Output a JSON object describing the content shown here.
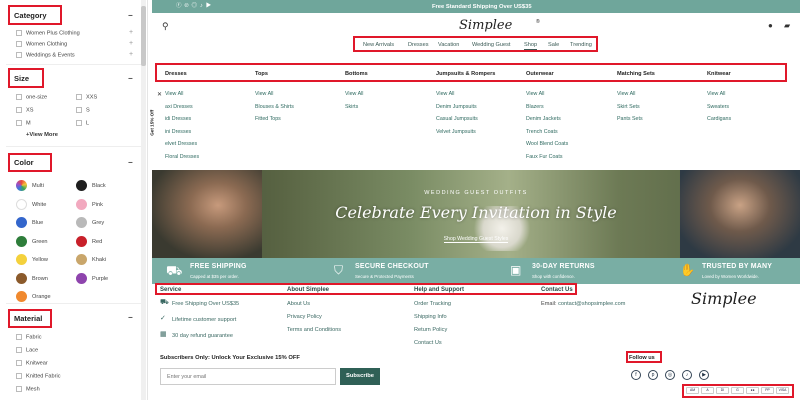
{
  "sidebar": {
    "category": {
      "title": "Category",
      "items": [
        "Women Plus Clothing",
        "Women Clothing",
        "Weddings & Events"
      ]
    },
    "size": {
      "title": "Size",
      "col1": [
        "one-size",
        "XS",
        "M"
      ],
      "col2": [
        "XXS",
        "S",
        "L"
      ],
      "more": "+View More"
    },
    "color": {
      "title": "Color",
      "items": [
        {
          "label": "Multi",
          "hex": "multi"
        },
        {
          "label": "Black",
          "hex": "#1e1e1e"
        },
        {
          "label": "White",
          "hex": "#ffffff"
        },
        {
          "label": "Pink",
          "hex": "#f2a9bf"
        },
        {
          "label": "Blue",
          "hex": "#3366cc"
        },
        {
          "label": "Grey",
          "hex": "#b9b9b9"
        },
        {
          "label": "Green",
          "hex": "#2e7d3a"
        },
        {
          "label": "Red",
          "hex": "#c8202a"
        },
        {
          "label": "Yellow",
          "hex": "#f4d13c"
        },
        {
          "label": "Khaki",
          "hex": "#c9a66b"
        },
        {
          "label": "Brown",
          "hex": "#8b5a2b"
        },
        {
          "label": "Purple",
          "hex": "#8e44ad"
        },
        {
          "label": "Orange",
          "hex": "#f0892e"
        }
      ]
    },
    "material": {
      "title": "Material",
      "items": [
        "Fabric",
        "Lace",
        "Knitwear",
        "Knitted Fabric",
        "Mesh"
      ]
    }
  },
  "topbar": {
    "shipping_text": "Free Standard Shipping Over US$35"
  },
  "header": {
    "logo": "Simplee"
  },
  "nav": [
    "New Arrivals",
    "Dresses",
    "Vacation",
    "Wedding Guest",
    "Shop",
    "Sale",
    "Trending"
  ],
  "mega_menu": {
    "side_tab": "Get 15% Off",
    "columns": [
      {
        "title": "Dresses",
        "items": [
          "View All",
          "axi Dresses",
          "idi Dresses",
          "ini Dresses",
          "elvet Dresses",
          "Floral Dresses"
        ]
      },
      {
        "title": "Tops",
        "items": [
          "View All",
          "Blouses & Shirts",
          "Fitted Tops"
        ]
      },
      {
        "title": "Bottoms",
        "items": [
          "View All",
          "Skirts"
        ]
      },
      {
        "title": "Jumpsuits & Rompers",
        "items": [
          "View All",
          "Denim Jumpsuits",
          "Casual Jumpsuits",
          "Velvet Jumpsuits"
        ]
      },
      {
        "title": "Outerwear",
        "items": [
          "View All",
          "Blazers",
          "Denim Jackets",
          "Trench Coats",
          "Wool Blend Coats",
          "Faux Fur Coats"
        ]
      },
      {
        "title": "Matching Sets",
        "items": [
          "View All",
          "Skirt Sets",
          "Pants Sets"
        ]
      },
      {
        "title": "Knitwear",
        "items": [
          "View All",
          "Sweaters",
          "Cardigans"
        ]
      }
    ]
  },
  "banner": {
    "kicker": "WEDDING GUEST OUTFITS",
    "headline": "Celebrate Every Invitation in Style",
    "link": "Shop Wedding Guest Styles"
  },
  "trust": [
    {
      "title": "FREE SHIPPING",
      "sub": "Capped at $35 per order."
    },
    {
      "title": "SECURE CHECKOUT",
      "sub": "Secure & Protected Payments"
    },
    {
      "title": "30-DAY RETURNS",
      "sub": "Shop with confidence."
    },
    {
      "title": "TRUSTED BY MANY",
      "sub": "Loved by Women Worldwide."
    }
  ],
  "footer": {
    "service": {
      "title": "Service",
      "items": [
        "Free Shipping Over US$35",
        "Lifetime customer support",
        "30 day refund guarantee"
      ]
    },
    "about": {
      "title": "About Simplee",
      "items": [
        "About Us",
        "Privacy Policy",
        "Terms and Conditions"
      ]
    },
    "help": {
      "title": "Help and Support",
      "items": [
        "Order Tracking",
        "Shipping Info",
        "Return Policy",
        "Contact Us"
      ]
    },
    "contact": {
      "title": "Contact Us",
      "email_label": "Email:",
      "email": "contact@shopsimplee.com"
    },
    "logo": "Simplee",
    "subscribe": {
      "title": "Subscribers Only: Unlock Your Exclusive 15% OFF",
      "placeholder": "Enter your email",
      "button": "Subscribe"
    },
    "follow": "Follow us"
  },
  "colors": {
    "teal": "#6fa69b",
    "accent_red": "#e0182a",
    "menu_link": "#2f6a60"
  }
}
